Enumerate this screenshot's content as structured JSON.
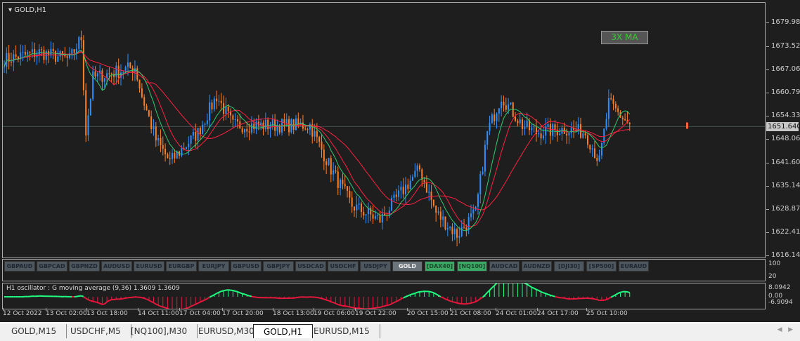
{
  "chart": {
    "title": "GOLD,H1",
    "indicator_label": "3X MA",
    "current_price": "1651.640",
    "price_ticks": [
      "1679.980",
      "1673.520",
      "1667.060",
      "1660.790",
      "1654.330",
      "1648.060",
      "1641.600",
      "1635.140",
      "1628.870",
      "1622.410",
      "1616.140"
    ],
    "ylim": [
      1616.14,
      1679.98
    ],
    "price_path": [
      [
        0,
        1670
      ],
      [
        15,
        1672
      ],
      [
        28,
        1670
      ],
      [
        33,
        1676
      ],
      [
        35,
        1650
      ],
      [
        38,
        1665
      ],
      [
        56,
        1668
      ],
      [
        59,
        1660
      ],
      [
        65,
        1648
      ],
      [
        71,
        1642
      ],
      [
        83,
        1650
      ],
      [
        91,
        1660
      ],
      [
        98,
        1652
      ],
      [
        110,
        1652
      ],
      [
        131,
        1652
      ],
      [
        140,
        1640
      ],
      [
        149,
        1630
      ],
      [
        161,
        1626
      ],
      [
        173,
        1636
      ],
      [
        178,
        1640
      ],
      [
        185,
        1628
      ],
      [
        194,
        1622
      ],
      [
        202,
        1628
      ],
      [
        207,
        1650
      ],
      [
        213,
        1660
      ],
      [
        222,
        1652
      ],
      [
        228,
        1650
      ],
      [
        240,
        1651
      ],
      [
        249,
        1650
      ],
      [
        255,
        1642
      ],
      [
        259,
        1658
      ],
      [
        268,
        1652
      ]
    ],
    "colors": {
      "bull": "#2f8fff",
      "bear": "#ff7f27",
      "ma_red": "#ff2040",
      "ma_green": "#2ecc71",
      "osc_pos": "#20ff80",
      "osc_neg": "#e8173c"
    }
  },
  "symbol_buttons": [
    {
      "label": "GBPAUD"
    },
    {
      "label": "GBPCAD"
    },
    {
      "label": "GBPNZD"
    },
    {
      "label": "AUDUSD"
    },
    {
      "label": "EURUSD"
    },
    {
      "label": "EURGBP"
    },
    {
      "label": "EURJPY"
    },
    {
      "label": "GBPUSD"
    },
    {
      "label": "GBPJPY"
    },
    {
      "label": "USDCAD"
    },
    {
      "label": "USDCHF"
    },
    {
      "label": "USDJPY"
    },
    {
      "label": "GOLD",
      "state": "current"
    },
    {
      "label": "[DAX40]",
      "state": "green"
    },
    {
      "label": "[NQ100]",
      "state": "green"
    },
    {
      "label": "AUDCAD"
    },
    {
      "label": "AUDNZD"
    },
    {
      "label": "[DJI30]"
    },
    {
      "label": "[SP500]"
    },
    {
      "label": "EURAUD"
    }
  ],
  "button_panel_scale": [
    "100",
    "20"
  ],
  "oscillator": {
    "label": "H1  oscillator : G moving average (9,36)  1.3609 1.3609",
    "scale": [
      "8.0942",
      "0.00",
      "-6.9094"
    ]
  },
  "time_labels": [
    "12 Oct 2022",
    "13 Oct 02:00",
    "13 Oct 18:00",
    "14 Oct 11:00",
    "17 Oct 04:00",
    "17 Oct 20:00",
    "18 Oct 13:00",
    "19 Oct 06:00",
    "19 Oct 22:00",
    "20 Oct 15:00",
    "21 Oct 08:00",
    "24 Oct 01:00",
    "24 Oct 17:00",
    "25 Oct 10:00"
  ],
  "tabs": [
    {
      "label": "GOLD,M15"
    },
    {
      "label": "USDCHF,M5"
    },
    {
      "label": "[NQ100],M30"
    },
    {
      "label": "EURUSD,M30"
    },
    {
      "label": "GOLD,H1",
      "active": true
    },
    {
      "label": "EURUSD,M15"
    }
  ]
}
